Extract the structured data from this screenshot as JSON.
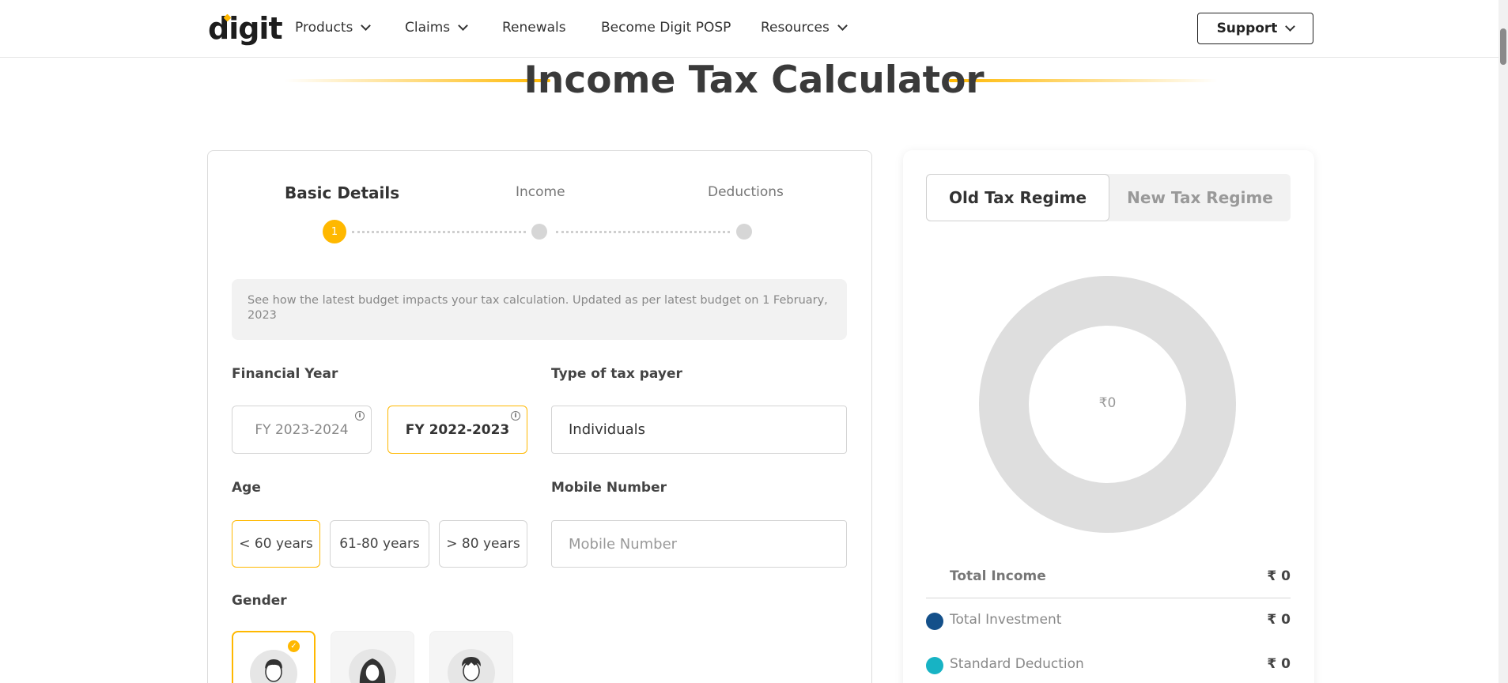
{
  "nav": {
    "logo": "digit",
    "items": [
      {
        "label": "Products",
        "dropdown": true
      },
      {
        "label": "Claims",
        "dropdown": true
      },
      {
        "label": "Renewals",
        "dropdown": false
      },
      {
        "label": "Become Digit POSP",
        "dropdown": false
      },
      {
        "label": "Resources",
        "dropdown": true
      }
    ],
    "support_label": "Support"
  },
  "page": {
    "title": "Income Tax Calculator"
  },
  "steps": [
    {
      "label": "Basic Details",
      "number": "1",
      "active": true
    },
    {
      "label": "Income",
      "active": false
    },
    {
      "label": "Deductions",
      "active": false
    }
  ],
  "info_text": "See how the latest budget impacts your tax calculation. Updated as per latest budget on 1 February, 2023",
  "form": {
    "financial_year": {
      "label": "Financial Year",
      "options": [
        "FY 2023-2024",
        "FY 2022-2023"
      ],
      "selected": "FY 2022-2023"
    },
    "tax_payer_type": {
      "label": "Type of tax payer",
      "value": "Individuals"
    },
    "age": {
      "label": "Age",
      "options": [
        "< 60 years",
        "61-80 years",
        "> 80 years"
      ],
      "selected": "< 60 years"
    },
    "mobile": {
      "label": "Mobile Number",
      "placeholder": "Mobile Number"
    },
    "gender": {
      "label": "Gender",
      "selected_index": 0,
      "icons": [
        "male-avatar-icon",
        "female-avatar-icon",
        "other-avatar-icon"
      ]
    }
  },
  "regime": {
    "tabs": [
      "Old Tax Regime",
      "New Tax Regime"
    ],
    "active": "Old Tax Regime"
  },
  "donut": {
    "center_value": "₹0",
    "ring_color": "#dedede"
  },
  "summary": [
    {
      "label": "Total Income",
      "value": "₹ 0",
      "color": null
    },
    {
      "label": "Total Investment",
      "value": "₹ 0",
      "color": "#14508a"
    },
    {
      "label": "Standard Deduction",
      "value": "₹ 0",
      "color": "#17b3c4"
    }
  ],
  "colors": {
    "accent": "#ffb800"
  }
}
